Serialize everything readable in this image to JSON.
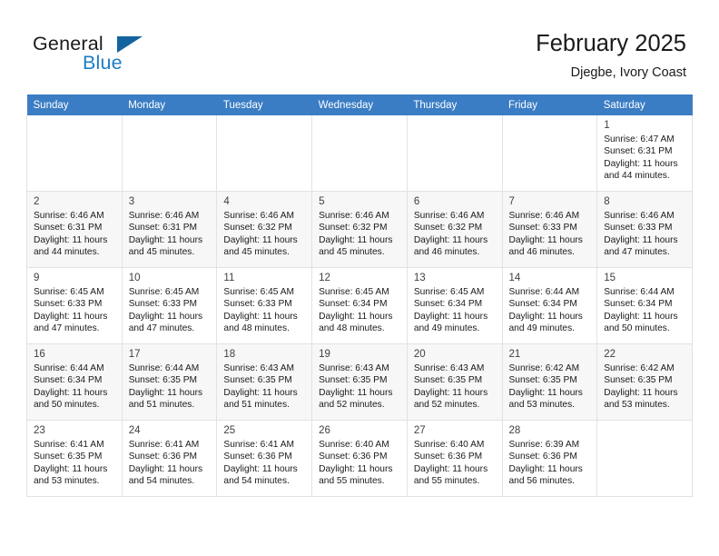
{
  "brand": {
    "name_top": "General",
    "name_bottom": "Blue",
    "triangle_color": "#13639f",
    "blue_color": "#1f7dc4"
  },
  "header": {
    "title": "February 2025",
    "subtitle": "Djegbe, Ivory Coast"
  },
  "theme": {
    "header_row_bg": "#3b7dc4",
    "header_row_text": "#ffffff",
    "shaded_row_bg": "#f7f7f7",
    "cell_border": "#e2e2e2"
  },
  "calendar": {
    "weekday_headers": [
      "Sunday",
      "Monday",
      "Tuesday",
      "Wednesday",
      "Thursday",
      "Friday",
      "Saturday"
    ],
    "labels": {
      "sunrise": "Sunrise:",
      "sunset": "Sunset:",
      "daylight": "Daylight:"
    },
    "weeks": [
      {
        "shaded": false,
        "days": [
          {
            "empty": true
          },
          {
            "empty": true
          },
          {
            "empty": true
          },
          {
            "empty": true
          },
          {
            "empty": true
          },
          {
            "empty": true
          },
          {
            "empty": false,
            "date": "1",
            "sunrise": "Sunrise: 6:47 AM",
            "sunset": "Sunset: 6:31 PM",
            "daylight_l1": "Daylight: 11 hours",
            "daylight_l2": "and 44 minutes."
          }
        ]
      },
      {
        "shaded": true,
        "days": [
          {
            "empty": false,
            "date": "2",
            "sunrise": "Sunrise: 6:46 AM",
            "sunset": "Sunset: 6:31 PM",
            "daylight_l1": "Daylight: 11 hours",
            "daylight_l2": "and 44 minutes."
          },
          {
            "empty": false,
            "date": "3",
            "sunrise": "Sunrise: 6:46 AM",
            "sunset": "Sunset: 6:31 PM",
            "daylight_l1": "Daylight: 11 hours",
            "daylight_l2": "and 45 minutes."
          },
          {
            "empty": false,
            "date": "4",
            "sunrise": "Sunrise: 6:46 AM",
            "sunset": "Sunset: 6:32 PM",
            "daylight_l1": "Daylight: 11 hours",
            "daylight_l2": "and 45 minutes."
          },
          {
            "empty": false,
            "date": "5",
            "sunrise": "Sunrise: 6:46 AM",
            "sunset": "Sunset: 6:32 PM",
            "daylight_l1": "Daylight: 11 hours",
            "daylight_l2": "and 45 minutes."
          },
          {
            "empty": false,
            "date": "6",
            "sunrise": "Sunrise: 6:46 AM",
            "sunset": "Sunset: 6:32 PM",
            "daylight_l1": "Daylight: 11 hours",
            "daylight_l2": "and 46 minutes."
          },
          {
            "empty": false,
            "date": "7",
            "sunrise": "Sunrise: 6:46 AM",
            "sunset": "Sunset: 6:33 PM",
            "daylight_l1": "Daylight: 11 hours",
            "daylight_l2": "and 46 minutes."
          },
          {
            "empty": false,
            "date": "8",
            "sunrise": "Sunrise: 6:46 AM",
            "sunset": "Sunset: 6:33 PM",
            "daylight_l1": "Daylight: 11 hours",
            "daylight_l2": "and 47 minutes."
          }
        ]
      },
      {
        "shaded": false,
        "days": [
          {
            "empty": false,
            "date": "9",
            "sunrise": "Sunrise: 6:45 AM",
            "sunset": "Sunset: 6:33 PM",
            "daylight_l1": "Daylight: 11 hours",
            "daylight_l2": "and 47 minutes."
          },
          {
            "empty": false,
            "date": "10",
            "sunrise": "Sunrise: 6:45 AM",
            "sunset": "Sunset: 6:33 PM",
            "daylight_l1": "Daylight: 11 hours",
            "daylight_l2": "and 47 minutes."
          },
          {
            "empty": false,
            "date": "11",
            "sunrise": "Sunrise: 6:45 AM",
            "sunset": "Sunset: 6:33 PM",
            "daylight_l1": "Daylight: 11 hours",
            "daylight_l2": "and 48 minutes."
          },
          {
            "empty": false,
            "date": "12",
            "sunrise": "Sunrise: 6:45 AM",
            "sunset": "Sunset: 6:34 PM",
            "daylight_l1": "Daylight: 11 hours",
            "daylight_l2": "and 48 minutes."
          },
          {
            "empty": false,
            "date": "13",
            "sunrise": "Sunrise: 6:45 AM",
            "sunset": "Sunset: 6:34 PM",
            "daylight_l1": "Daylight: 11 hours",
            "daylight_l2": "and 49 minutes."
          },
          {
            "empty": false,
            "date": "14",
            "sunrise": "Sunrise: 6:44 AM",
            "sunset": "Sunset: 6:34 PM",
            "daylight_l1": "Daylight: 11 hours",
            "daylight_l2": "and 49 minutes."
          },
          {
            "empty": false,
            "date": "15",
            "sunrise": "Sunrise: 6:44 AM",
            "sunset": "Sunset: 6:34 PM",
            "daylight_l1": "Daylight: 11 hours",
            "daylight_l2": "and 50 minutes."
          }
        ]
      },
      {
        "shaded": true,
        "days": [
          {
            "empty": false,
            "date": "16",
            "sunrise": "Sunrise: 6:44 AM",
            "sunset": "Sunset: 6:34 PM",
            "daylight_l1": "Daylight: 11 hours",
            "daylight_l2": "and 50 minutes."
          },
          {
            "empty": false,
            "date": "17",
            "sunrise": "Sunrise: 6:44 AM",
            "sunset": "Sunset: 6:35 PM",
            "daylight_l1": "Daylight: 11 hours",
            "daylight_l2": "and 51 minutes."
          },
          {
            "empty": false,
            "date": "18",
            "sunrise": "Sunrise: 6:43 AM",
            "sunset": "Sunset: 6:35 PM",
            "daylight_l1": "Daylight: 11 hours",
            "daylight_l2": "and 51 minutes."
          },
          {
            "empty": false,
            "date": "19",
            "sunrise": "Sunrise: 6:43 AM",
            "sunset": "Sunset: 6:35 PM",
            "daylight_l1": "Daylight: 11 hours",
            "daylight_l2": "and 52 minutes."
          },
          {
            "empty": false,
            "date": "20",
            "sunrise": "Sunrise: 6:43 AM",
            "sunset": "Sunset: 6:35 PM",
            "daylight_l1": "Daylight: 11 hours",
            "daylight_l2": "and 52 minutes."
          },
          {
            "empty": false,
            "date": "21",
            "sunrise": "Sunrise: 6:42 AM",
            "sunset": "Sunset: 6:35 PM",
            "daylight_l1": "Daylight: 11 hours",
            "daylight_l2": "and 53 minutes."
          },
          {
            "empty": false,
            "date": "22",
            "sunrise": "Sunrise: 6:42 AM",
            "sunset": "Sunset: 6:35 PM",
            "daylight_l1": "Daylight: 11 hours",
            "daylight_l2": "and 53 minutes."
          }
        ]
      },
      {
        "shaded": false,
        "days": [
          {
            "empty": false,
            "date": "23",
            "sunrise": "Sunrise: 6:41 AM",
            "sunset": "Sunset: 6:35 PM",
            "daylight_l1": "Daylight: 11 hours",
            "daylight_l2": "and 53 minutes."
          },
          {
            "empty": false,
            "date": "24",
            "sunrise": "Sunrise: 6:41 AM",
            "sunset": "Sunset: 6:36 PM",
            "daylight_l1": "Daylight: 11 hours",
            "daylight_l2": "and 54 minutes."
          },
          {
            "empty": false,
            "date": "25",
            "sunrise": "Sunrise: 6:41 AM",
            "sunset": "Sunset: 6:36 PM",
            "daylight_l1": "Daylight: 11 hours",
            "daylight_l2": "and 54 minutes."
          },
          {
            "empty": false,
            "date": "26",
            "sunrise": "Sunrise: 6:40 AM",
            "sunset": "Sunset: 6:36 PM",
            "daylight_l1": "Daylight: 11 hours",
            "daylight_l2": "and 55 minutes."
          },
          {
            "empty": false,
            "date": "27",
            "sunrise": "Sunrise: 6:40 AM",
            "sunset": "Sunset: 6:36 PM",
            "daylight_l1": "Daylight: 11 hours",
            "daylight_l2": "and 55 minutes."
          },
          {
            "empty": false,
            "date": "28",
            "sunrise": "Sunrise: 6:39 AM",
            "sunset": "Sunset: 6:36 PM",
            "daylight_l1": "Daylight: 11 hours",
            "daylight_l2": "and 56 minutes."
          },
          {
            "empty": true
          }
        ]
      }
    ]
  }
}
